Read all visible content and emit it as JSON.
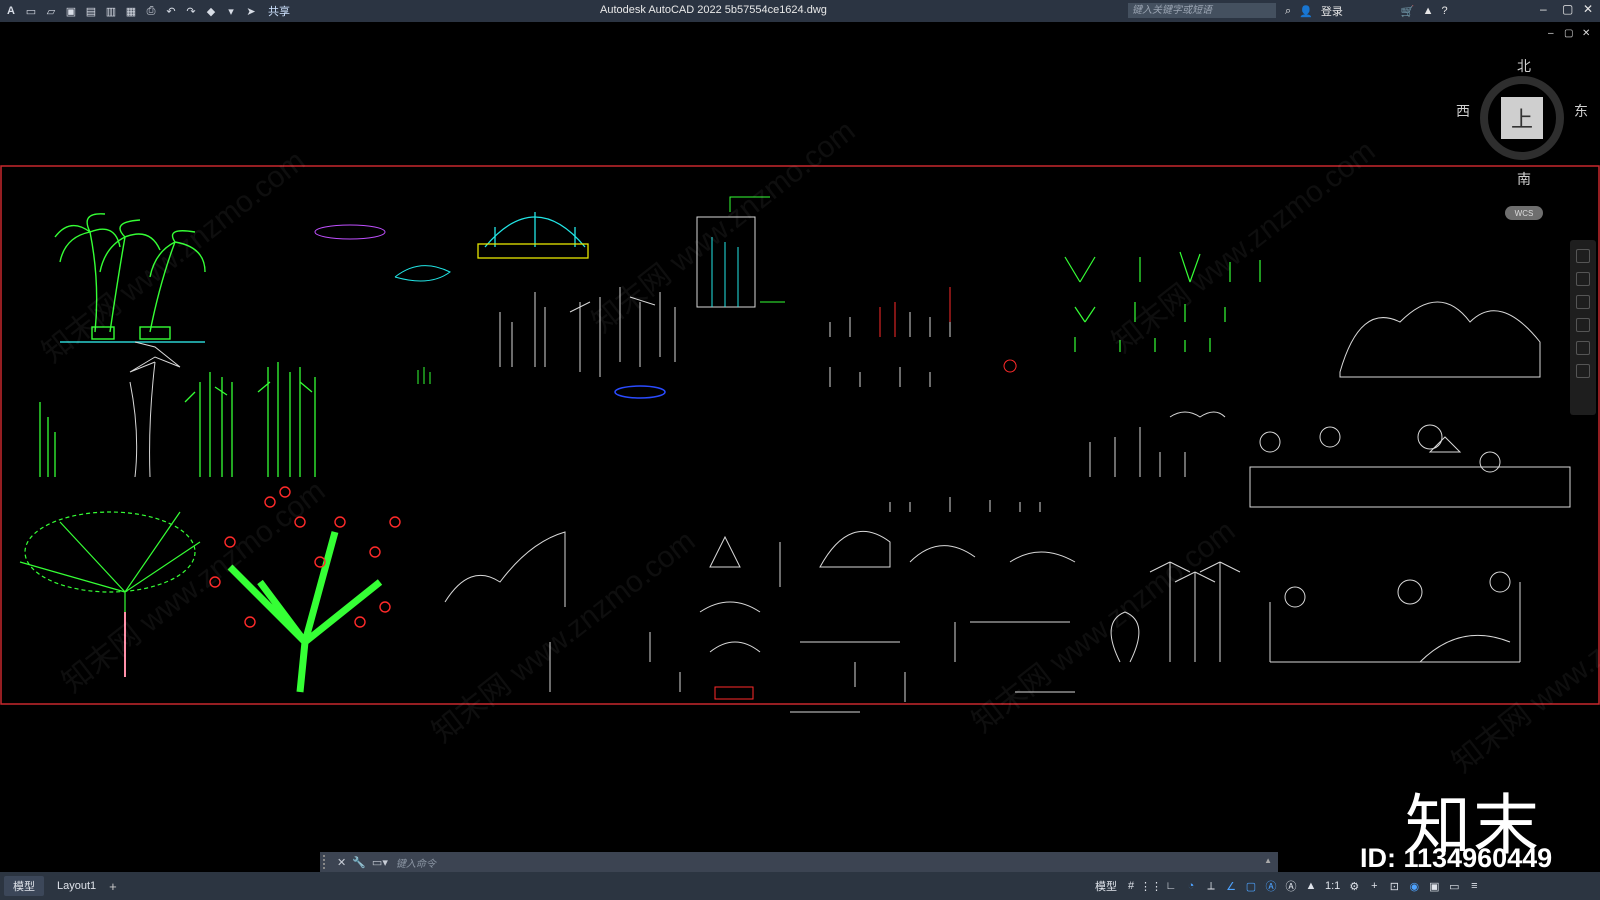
{
  "titlebar": {
    "app_logo": "A",
    "share_label": "共享",
    "title": "Autodesk AutoCAD 2022    5b57554ce1624.dwg",
    "search_placeholder": "键入关键字或短语",
    "login_label": "登录",
    "help_label": "?"
  },
  "viewcube": {
    "north": "北",
    "south": "南",
    "east": "东",
    "west": "西",
    "face": "上",
    "wcs_label": "WCS"
  },
  "watermark": {
    "text": "知末网 www.znzmo.com"
  },
  "brand": {
    "logo_text": "知末",
    "id_text": "ID: 1134960449"
  },
  "command_line": {
    "placeholder": "键入命令"
  },
  "status_bar": {
    "tabs": [
      "模型",
      "Layout1"
    ],
    "model_label": "模型",
    "scale_label": "1:1"
  },
  "colors": {
    "titlebar": "#2b3442",
    "canvas": "#000000",
    "frame_red": "#c8282d",
    "green": "#35ff35",
    "cyan": "#22e6e6",
    "red": "#ff2a2a",
    "white_lines": "#d9d9d9",
    "blue": "#2a4bff"
  }
}
